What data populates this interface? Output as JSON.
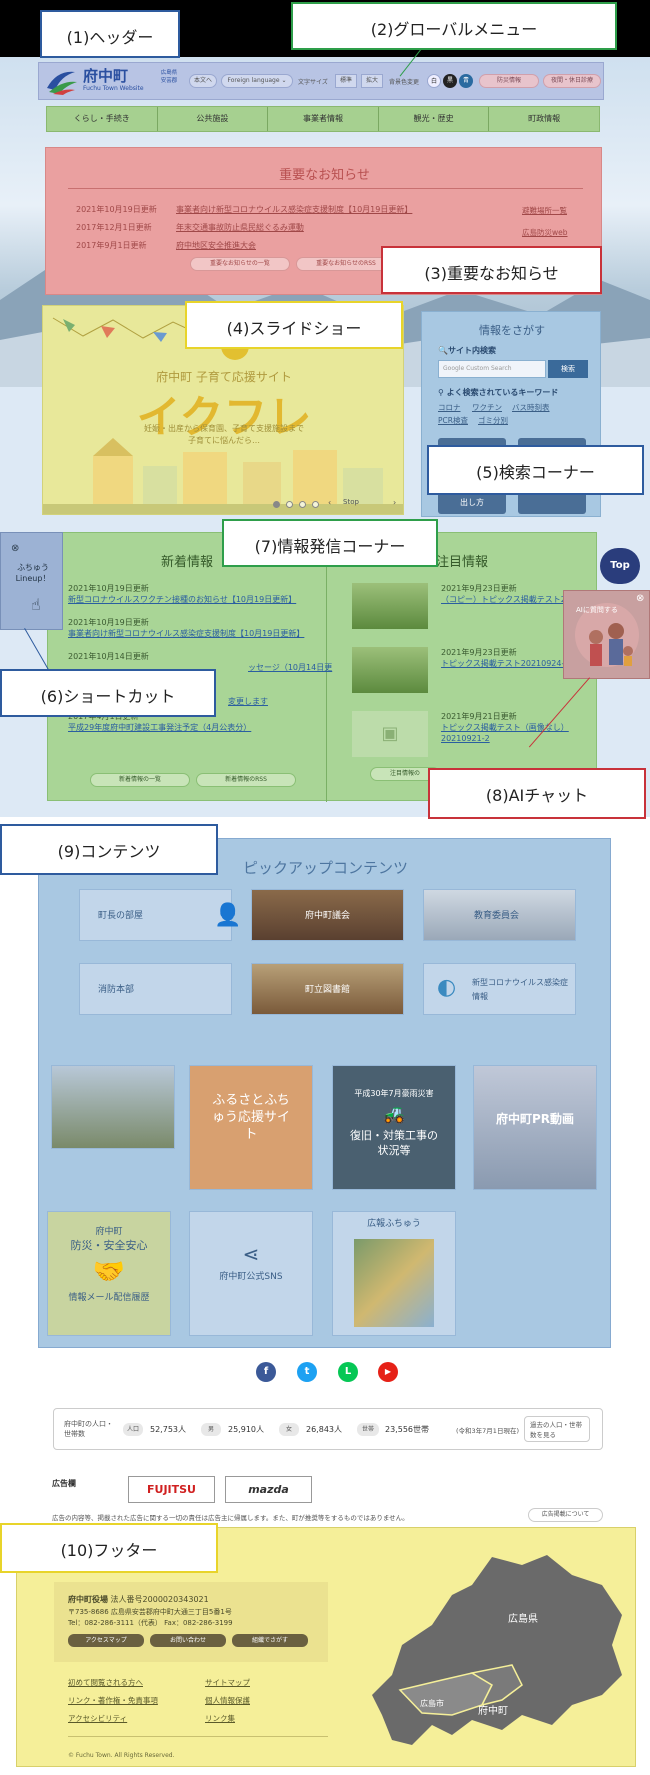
{
  "labels": {
    "header": "(1)ヘッダー",
    "global_menu": "(2)グローバルメニュー",
    "notice": "(3)重要なお知らせ",
    "slideshow": "(4)スライドショー",
    "search": "(5)検索コーナー",
    "info": "(7)情報発信コーナー",
    "shortcut": "(6)ショートカット",
    "ai_chat": "(8)AIチャット",
    "contents": "(9)コンテンツ",
    "footer": "(10)フッター"
  },
  "header": {
    "logo_text": "府中町",
    "logo_sub": "Fuchu Town Website",
    "logo_badge": "広島県安芸郡",
    "skip_link": "本文へ",
    "language": "Foreign language",
    "font_size_label": "文字サイズ",
    "font_standard": "標準",
    "font_large": "拡大",
    "color_label": "背景色変更",
    "color_white": "白",
    "color_black": "黒",
    "color_blue": "青",
    "disaster_btn": "防災情報",
    "holiday_btn": "夜間・休日診療"
  },
  "nav": {
    "items": [
      "くらし・手続き",
      "公共施設",
      "事業者情報",
      "観光・歴史",
      "町政情報"
    ]
  },
  "notice": {
    "title": "重要なお知らせ",
    "items": [
      {
        "date": "2021年10月19日更新",
        "text": "事業者向け新型コロナウイルス感染症支援制度【10月19日更新】"
      },
      {
        "date": "2017年12月1日更新",
        "text": "年末交通事故防止県民総ぐるみ運動"
      },
      {
        "date": "2017年9月1日更新",
        "text": "府中地区安全推進大会"
      }
    ],
    "side_links": [
      "避難場所一覧",
      "広島防災web"
    ],
    "list_btn": "重要なお知らせの一覧",
    "rss_btn": "重要なお知らせのRSS"
  },
  "slideshow": {
    "title": "府中町 子育て応援サイト",
    "big": "イクフレ",
    "sub1": "妊娠・出産から保育園、子育て支援施設まで",
    "sub2": "子育てに悩んだら…",
    "stop": "Stop"
  },
  "search": {
    "title": "情報をさがす",
    "site_search": "サイト内検索",
    "placeholder": "Google Custom Search",
    "button": "検索",
    "keyword_title": "よく検索されているキーワード",
    "keywords": [
      "コロナ",
      "ワクチン",
      "バス時刻表",
      "PCR検査",
      "ゴミ分別"
    ],
    "bottom_btn": "出し方"
  },
  "info": {
    "news_title": "新着情報",
    "featured_title": "注目情報",
    "news": [
      {
        "date": "2021年10月19日更新",
        "text": "新型コロナウイルスワクチン接種のお知らせ【10月19日更新】"
      },
      {
        "date": "2021年10月19日更新",
        "text": "事業者向け新型コロナウイルス感染症支援制度【10月19日更新】"
      },
      {
        "date": "2021年10月14日更新",
        "text": "ッセージ（10月14日更"
      },
      {
        "date": "",
        "text": "変更します"
      },
      {
        "date": "2017年4月1日更新",
        "text": "平成29年度府中町建設工事発注予定（4月公表分）"
      }
    ],
    "featured": [
      {
        "date": "2021年9月23日更新",
        "text": "（コピー）トピックス掲載テスト20210924-2"
      },
      {
        "date": "2021年9月23日更新",
        "text": "トピックス掲載テスト20210924-1"
      },
      {
        "date": "2021年9月21日更新",
        "text": "トピックス掲載テスト（画像なし）20210921-2"
      }
    ],
    "news_list_btn": "新着情報の一覧",
    "news_rss_btn": "新着情報のRSS",
    "featured_list_btn": "注目情報の"
  },
  "shortcut": {
    "label": "ふちゅう Lineup！"
  },
  "top_btn": "Top",
  "ai_chat": {
    "label": "AIに質問する"
  },
  "contents": {
    "title": "ピックアップコンテンツ",
    "row1": [
      "町長の部屋",
      "府中町議会",
      "教育委員会"
    ],
    "row2": [
      "消防本部",
      "町立図書館",
      "新型コロナウイルス感染症情報"
    ],
    "furusato": "ふるさとふちゅう応援サイト",
    "recovery_top": "平成30年7月豪雨災害",
    "recovery_main": "復旧・対策工事の状況等",
    "pr_video": "府中町PR動画",
    "bousai_top": "府中町",
    "bousai_mid": "防災・安全安心",
    "bousai_bottom": "情報メール配信履歴",
    "sns_label": "府中町公式SNS",
    "kouhou": "広報ふちゅう"
  },
  "social": {
    "facebook": "f",
    "twitter": "t",
    "line": "L",
    "youtube": "▶"
  },
  "population": {
    "label": "府中町の人口・世帯数",
    "total_tag": "人口",
    "total": "52,753人",
    "male_tag": "男",
    "male": "25,910人",
    "female_tag": "女",
    "female": "26,843人",
    "household_tag": "世帯",
    "household": "23,556世帯",
    "as_of": "(令和3年7月1日現在)",
    "past_btn": "過去の人口・世帯数を見る"
  },
  "ads": {
    "label": "広告欄",
    "fujitsu": "FUJITSU",
    "mazda": "mazda",
    "note": "広告の内容等、掲載された広告に関する一切の責任は広告主に帰属します。また、町が推奨等をするものではありません。",
    "about": "広告掲載について"
  },
  "footer": {
    "office": "府中町役場",
    "corp_no": "法人番号2000020343021",
    "address": "〒735-8686 広島県安芸郡府中町大通三丁目5番1号",
    "tel": "Tel：082-286-3111（代表） Fax：082-286-3199",
    "access_btn": "アクセスマップ",
    "contact_btn": "お問い合わせ",
    "org_btn": "組織でさがす",
    "links": [
      "初めて閲覧される方へ",
      "サイトマップ",
      "リンク・著作権・免責事項",
      "個人情報保護",
      "アクセシビリティ",
      "リンク集"
    ],
    "copyright": "© Fuchu Town. All Rights Reserved.",
    "map_pref": "広島県",
    "map_city": "広島市",
    "map_town": "府中町"
  },
  "colors": {
    "header": "#b8c4e4",
    "nav": "#a6d090",
    "notice": "#eaa0a0",
    "slide": "#e8e89a",
    "search": "#a8c8e2",
    "info": "#a9d596",
    "contents": "#a9c8e2",
    "footer": "#f5ef99"
  }
}
